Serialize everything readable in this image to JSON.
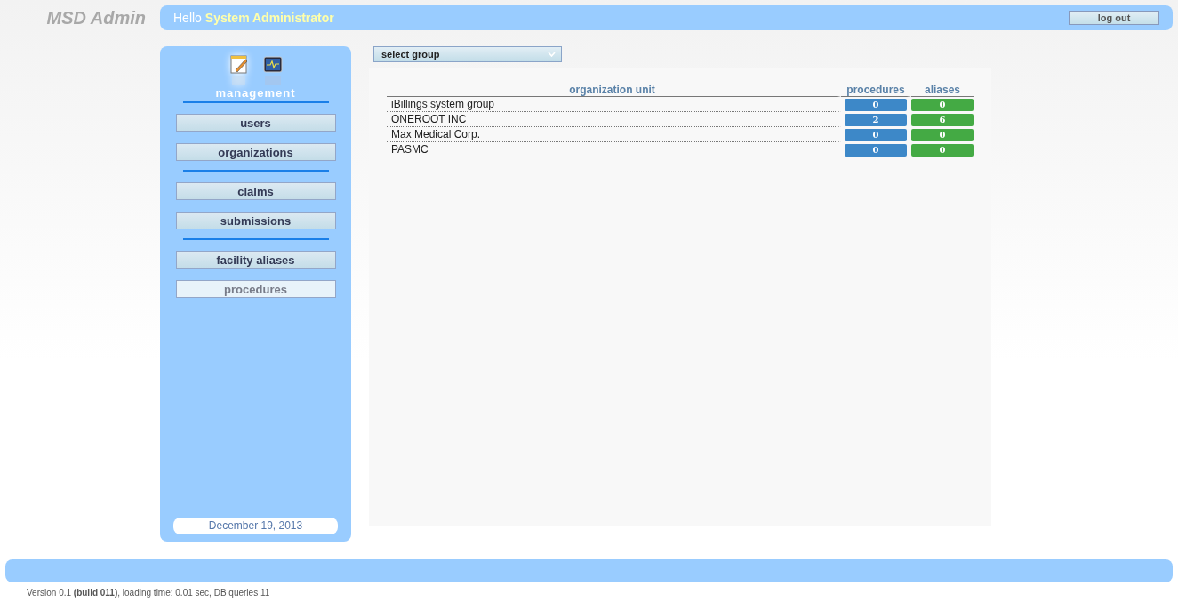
{
  "logo": "MSD Admin",
  "header": {
    "greeting": "Hello",
    "user": "System Administrator",
    "logout": "log out"
  },
  "sidebar": {
    "modules": [
      {
        "kind": "notepad",
        "selected": true
      },
      {
        "kind": "monitor",
        "selected": false
      }
    ],
    "section": "management",
    "groups": [
      [
        {
          "label": "users",
          "selected": false
        },
        {
          "label": "organizations",
          "selected": false
        }
      ],
      [
        {
          "label": "claims",
          "selected": false
        },
        {
          "label": "submissions",
          "selected": false
        }
      ],
      [
        {
          "label": "facility aliases",
          "selected": false
        },
        {
          "label": "procedures",
          "selected": true
        }
      ]
    ],
    "date": "December 19, 2013"
  },
  "group_select": {
    "value": "select group"
  },
  "table": {
    "columns": [
      "organization unit",
      "procedures",
      "aliases"
    ],
    "rows": [
      {
        "unit": "iBillings system group",
        "procedures": "0",
        "aliases": "0"
      },
      {
        "unit": "ONEROOT INC",
        "procedures": "2",
        "aliases": "6"
      },
      {
        "unit": "Max Medical Corp.",
        "procedures": "0",
        "aliases": "0"
      },
      {
        "unit": "PASMC",
        "procedures": "0",
        "aliases": "0"
      }
    ]
  },
  "footer": "Version 0.1 **(build 011)**, loading time: 0.01 sec, DB queries 11"
}
